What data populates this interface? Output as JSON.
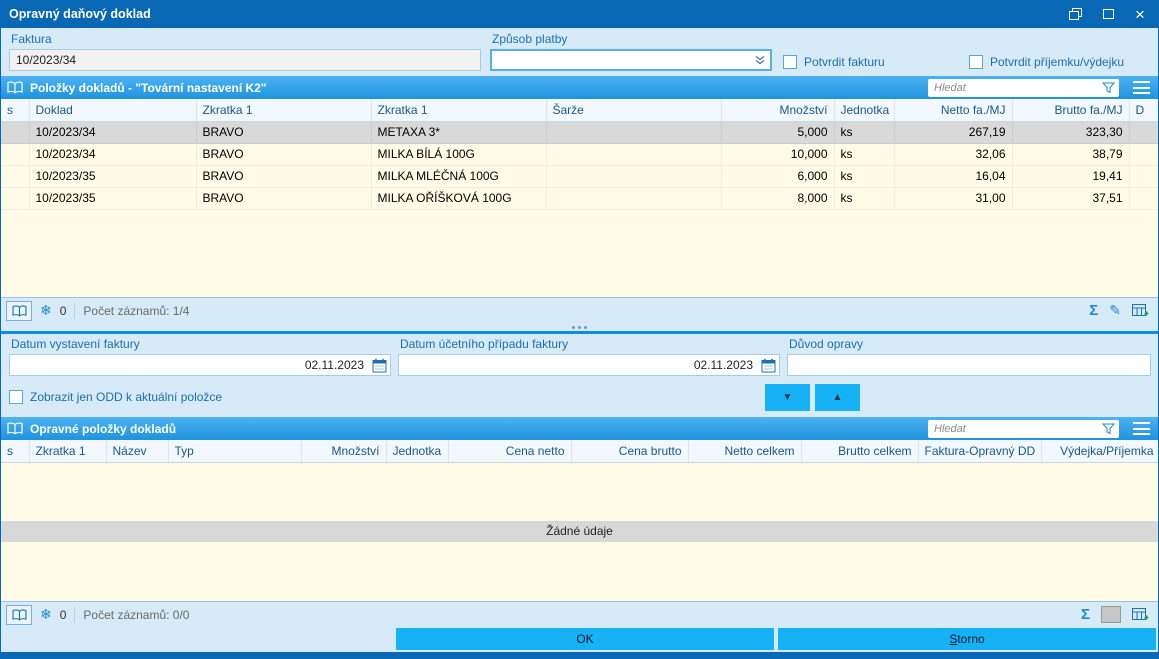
{
  "window": {
    "title": "Opravný daňový doklad"
  },
  "icons": {
    "close": "×",
    "snowflake": "❄",
    "sigma": "Σ",
    "pencil": "✎",
    "arrow_down": "▼",
    "arrow_up": "▲"
  },
  "top_form": {
    "faktura_label": "Faktura",
    "faktura_value": "10/2023/34",
    "zpusob_platby_label": "Způsob platby",
    "zpusob_platby_value": "",
    "potvrdit_fakturu_label": "Potvrdit fakturu",
    "potvrdit_prijemku_label": "Potvrdit příjemku/výdejku"
  },
  "items_panel": {
    "title": "Položky dokladů - \"Tovární nastavení K2\"",
    "search_placeholder": "Hledat",
    "table": {
      "columns": [
        "s",
        "Doklad",
        "Zkratka 1",
        "Zkratka 1",
        "Šarže",
        "Množství",
        "Jednotka",
        "Netto fa./MJ",
        "Brutto fa./MJ",
        "D"
      ],
      "selected_row": 0,
      "rows": [
        [
          "",
          "10/2023/34",
          "BRAVO",
          "METAXA 3*",
          "",
          "5,000",
          "ks",
          "267,19",
          "323,30",
          ""
        ],
        [
          "",
          "10/2023/34",
          "BRAVO",
          "MILKA BÍLÁ 100G",
          "",
          "10,000",
          "ks",
          "32,06",
          "38,79",
          ""
        ],
        [
          "",
          "10/2023/35",
          "BRAVO",
          "MILKA MLÉČNÁ 100G",
          "",
          "6,000",
          "ks",
          "16,04",
          "19,41",
          ""
        ],
        [
          "",
          "10/2023/35",
          "BRAVO",
          "MILKA OŘÍŠKOVÁ 100G",
          "",
          "8,000",
          "ks",
          "31,00",
          "37,51",
          ""
        ]
      ]
    },
    "status": {
      "flag_count": "0",
      "records_label": "Počet záznamů: 1/4"
    }
  },
  "middle_form": {
    "datum_vystaveni_label": "Datum vystavení faktury",
    "datum_vystaveni_value": "02.11.2023",
    "datum_ucetni_label": "Datum účetního případu faktury",
    "datum_ucetni_value": "02.11.2023",
    "duvod_opravy_label": "Důvod opravy",
    "duvod_opravy_value": "",
    "zobrazit_odd_label": "Zobrazit jen ODD k aktuální položce"
  },
  "corrections_panel": {
    "title": "Opravné položky dokladů",
    "search_placeholder": "Hledat",
    "table": {
      "columns": [
        "s",
        "Zkratka 1",
        "Název",
        "Typ",
        "Množství",
        "Jednotka",
        "Cena netto",
        "Cena brutto",
        "Netto celkem",
        "Brutto celkem",
        "Faktura-Opravný DD",
        "Výdejka/Příjemka"
      ],
      "rows": []
    },
    "empty_text": "Žádné údaje",
    "status": {
      "flag_count": "0",
      "records_label": "Počet záznamů: 0/0"
    }
  },
  "footer": {
    "ok_label": "OK",
    "storno_label": "Storno"
  }
}
